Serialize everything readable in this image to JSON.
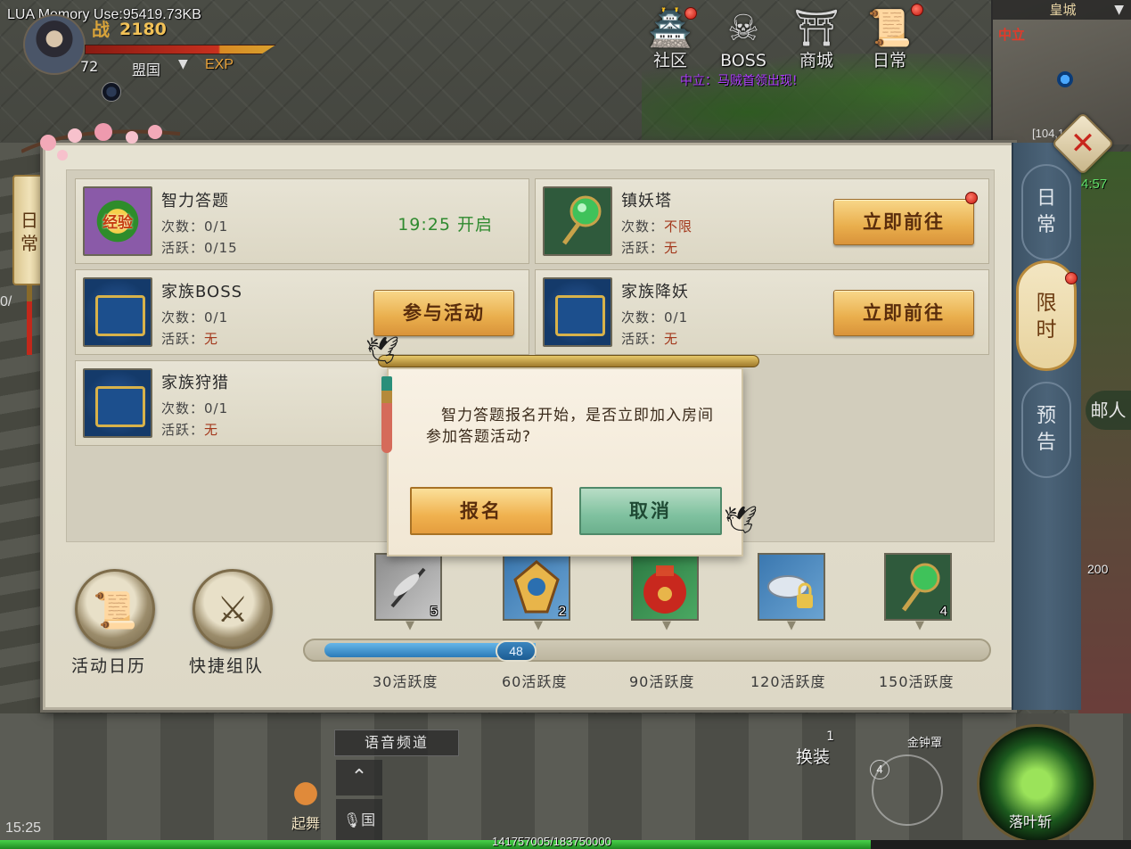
{
  "hud": {
    "lua_memory": "LUA Memory Use:95419.73KB",
    "power": "2180",
    "power_glyph": "战",
    "level": "72",
    "faction": "盟国",
    "exp_label": "EXP",
    "time": "15:25",
    "exp_progress_text": "141757005/183750000",
    "exp_progress_fraction": 0.77
  },
  "top_menu": [
    {
      "label": "社区",
      "icon": "community-icon",
      "glyph": "🏯"
    },
    {
      "label": "BOSS",
      "icon": "boss-icon",
      "glyph": "☠"
    },
    {
      "label": "商城",
      "icon": "shop-icon",
      "glyph": "⛩"
    },
    {
      "label": "日常",
      "icon": "daily-icon",
      "glyph": "📜"
    }
  ],
  "event_notice": "中立：马贼首领出现!",
  "minimap": {
    "title": "皇城",
    "zone": "中立",
    "coord": "[104,1",
    "clock": "4:57"
  },
  "side_tab": {
    "daily": "日常",
    "fraction": "0/"
  },
  "activities": [
    {
      "title": "智力答题",
      "count_label": "次数：",
      "count": "0/1",
      "active_label": "活跃：",
      "active": "0/15",
      "status": "19:25 开启",
      "icon": "exp-icon"
    },
    {
      "title": "镇妖塔",
      "count_label": "次数：",
      "count": "不限",
      "active_label": "活跃：",
      "active": "无",
      "button": "立即前往",
      "icon": "green-orb-wand-icon"
    },
    {
      "title": "家族BOSS",
      "count_label": "次数：",
      "count": "0/1",
      "active_label": "活跃：",
      "active": "无",
      "button": "参与活动",
      "icon": "chest-icon"
    },
    {
      "title": "家族降妖",
      "count_label": "次数：",
      "count": "0/1",
      "active_label": "活跃：",
      "active": "无",
      "button": "立即前往",
      "icon": "chest-icon"
    },
    {
      "title": "家族狩猎",
      "count_label": "次数：",
      "count": "0/1",
      "active_label": "活跃：",
      "active": "无",
      "icon": "chest-icon"
    }
  ],
  "bottom_buttons": {
    "calendar": "活动日历",
    "quick_team": "快捷组队"
  },
  "rewards": [
    {
      "icon": "dragonfly-icon",
      "count": "5",
      "milestone": "30活跃度"
    },
    {
      "icon": "talisman-icon",
      "count": "2",
      "milestone": "60活跃度"
    },
    {
      "icon": "red-pouch-icon",
      "count": "",
      "milestone": "90活跃度"
    },
    {
      "icon": "silver-ingot-icon",
      "count": "",
      "milestone": "120活跃度"
    },
    {
      "icon": "green-orb-wand-icon",
      "count": "4",
      "milestone": "150活跃度"
    }
  ],
  "activity_progress": {
    "value": "48",
    "max": 150
  },
  "right_tabs": [
    {
      "label": "日常",
      "active": false
    },
    {
      "label": "限时",
      "active": true
    },
    {
      "label": "预告",
      "active": false
    }
  ],
  "dialog": {
    "message": "智力答题报名开始，是否立即加入房间参加答题活动?",
    "signup": "报名",
    "cancel": "取消"
  },
  "bottom_hud": {
    "voice_channel": "语音频道",
    "mic_label": "国",
    "dance": "起舞",
    "change_outfit": "换装",
    "change_outfit_count": "1",
    "bell_skill": "金钟罩",
    "joystick_count": "4",
    "main_skill": "落叶斩",
    "side_skill_count": "200",
    "recruit": "邮人"
  }
}
